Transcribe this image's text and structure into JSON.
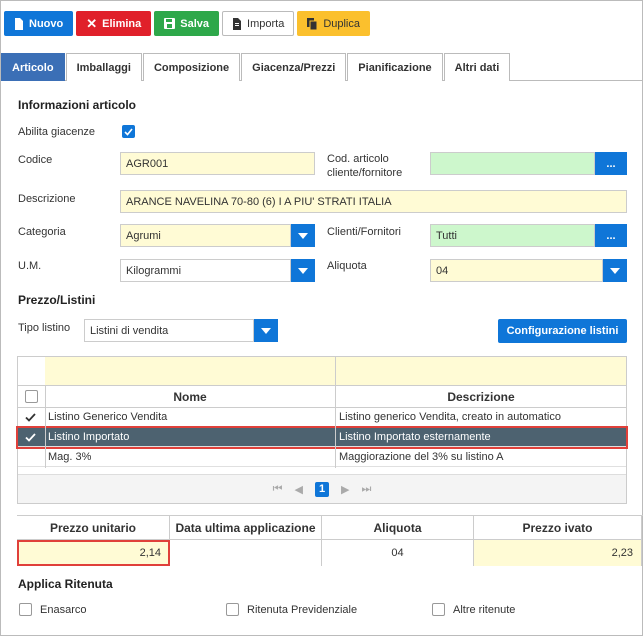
{
  "toolbar": {
    "nuovo": "Nuovo",
    "elimina": "Elimina",
    "salva": "Salva",
    "importa": "Importa",
    "duplica": "Duplica"
  },
  "tabs": [
    "Articolo",
    "Imballaggi",
    "Composizione",
    "Giacenza/Prezzi",
    "Pianificazione",
    "Altri dati"
  ],
  "info": {
    "title": "Informazioni articolo",
    "abilita_giacenze_label": "Abilita giacenze",
    "abilita_giacenze_checked": true,
    "codice_label": "Codice",
    "codice_value": "AGR001",
    "cod_articolo_label": "Cod. articolo cliente/fornitore",
    "cod_articolo_value": "",
    "descrizione_label": "Descrizione",
    "descrizione_value": "ARANCE NAVELINA 70-80 (6) I A PIU' STRATI     ITALIA",
    "categoria_label": "Categoria",
    "categoria_value": "Agrumi",
    "clienti_label": "Clienti/Fornitori",
    "clienti_value": "Tutti",
    "um_label": "U.M.",
    "um_value": "Kilogrammi",
    "aliquota_label": "Aliquota",
    "aliquota_value": "04",
    "dots": "..."
  },
  "prezzo": {
    "title": "Prezzo/Listini",
    "tipo_listino_label": "Tipo listino",
    "tipo_listino_value": "Listini di vendita",
    "config_button": "Configurazione listini"
  },
  "grid": {
    "columns": [
      "Nome",
      "Descrizione"
    ],
    "rows": [
      {
        "checked": true,
        "nome": "Listino Generico Vendita",
        "descrizione": "Listino generico Vendita, creato in automatico",
        "selected": false
      },
      {
        "checked": true,
        "nome": "Listino Importato",
        "descrizione": "Listino Importato esternamente",
        "selected": true
      },
      {
        "checked": false,
        "nome": "Mag. 3%",
        "descrizione": "Maggiorazione del 3% su listino A",
        "selected": false
      }
    ],
    "page": "1"
  },
  "prices": {
    "headers": [
      "Prezzo unitario",
      "Data ultima applicazione",
      "Aliquota",
      "Prezzo ivato"
    ],
    "prezzo_unitario": "2,14",
    "data_ultima": "",
    "aliquota": "04",
    "prezzo_ivato": "2,23"
  },
  "ritenuta": {
    "title": "Applica Ritenuta",
    "options": [
      "Enasarco",
      "Ritenuta Previdenziale",
      "Altre ritenute"
    ]
  },
  "colors": {
    "primary": "#0f76d8",
    "danger": "#e0202a",
    "success": "#2ea84a",
    "warning": "#fbc02d",
    "tab_active": "#3b6fb6",
    "row_selected": "#4d6270",
    "highlight_border": "#e0403a"
  }
}
